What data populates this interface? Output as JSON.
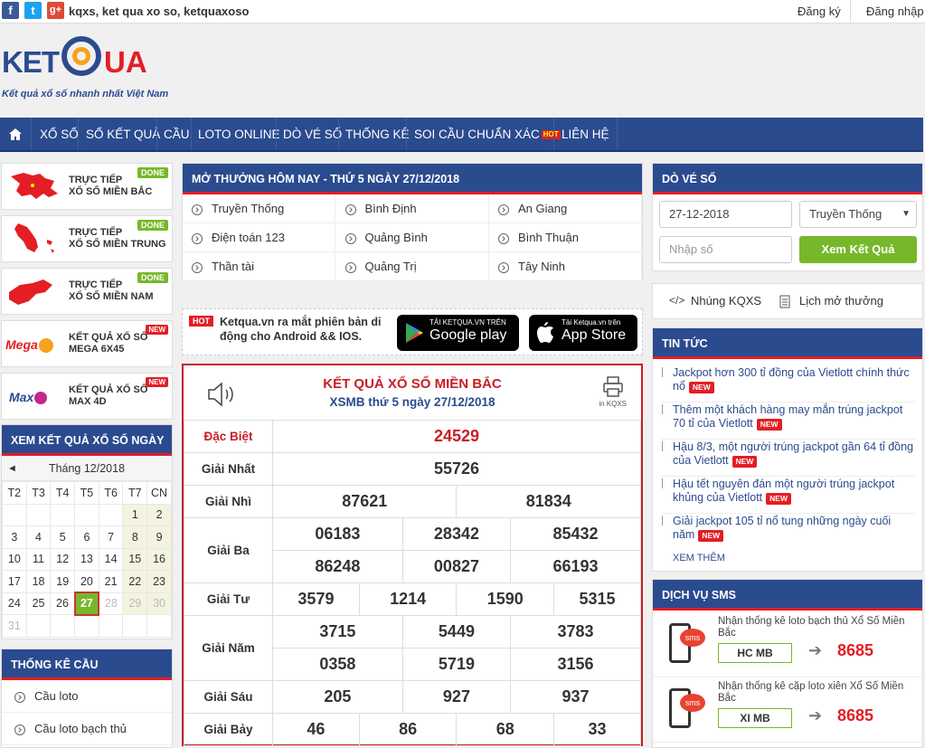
{
  "topbar": {
    "site_text": "kqxs, ket qua xo so, ketquaxoso",
    "register": "Đăng ký",
    "login": "Đăng nhập",
    "social": [
      {
        "name": "facebook-icon",
        "glyph": "f",
        "color": "#3b5998"
      },
      {
        "name": "twitter-icon",
        "glyph": "t",
        "color": "#1da1f2"
      },
      {
        "name": "google-plus-icon",
        "glyph": "g+",
        "color": "#dd4b39"
      }
    ]
  },
  "logo": {
    "text_left": "KET",
    "text_right": "UA",
    "tagline": "Kết quả xổ số nhanh nhất Việt Nam"
  },
  "nav": {
    "home_icon": "home-icon",
    "items": [
      "XỔ SỐ",
      "SỔ KẾT QUẢ",
      "CẦU",
      "LOTO ONLINE",
      "DÒ VÉ SỐ",
      "THỐNG KÊ",
      "SOI CẦU CHUẨN XÁC",
      "LIÊN HỆ"
    ],
    "hot_badge": "HOT"
  },
  "left_cards": [
    {
      "line1": "TRỰC TIẾP",
      "line2": "XỔ SỐ MIỀN BẮC",
      "badge": "DONE"
    },
    {
      "line1": "TRỰC TIẾP",
      "line2": "XỔ SỐ MIỀN TRUNG",
      "badge": "DONE"
    },
    {
      "line1": "TRỰC TIẾP",
      "line2": "XỔ SỐ MIỀN NAM",
      "badge": "DONE"
    },
    {
      "line1": "KẾT QUẢ XỔ SỐ",
      "line2": "MEGA 6X45",
      "badge": "NEW",
      "logo": "Mega"
    },
    {
      "line1": "KẾT QUẢ XỔ SỐ",
      "line2": "MAX 4D",
      "badge": "NEW",
      "logo": "Max"
    }
  ],
  "calendar": {
    "title": "XEM KẾT QUẢ XỔ SỐ NGÀY",
    "month": "Tháng 12/2018",
    "prev": "◄",
    "weekdays": [
      "T2",
      "T3",
      "T4",
      "T5",
      "T6",
      "T7",
      "CN"
    ],
    "weeks": [
      [
        "",
        "",
        "",
        "",
        "",
        "1",
        "2"
      ],
      [
        "3",
        "4",
        "5",
        "6",
        "7",
        "8",
        "9"
      ],
      [
        "10",
        "11",
        "12",
        "13",
        "14",
        "15",
        "16"
      ],
      [
        "17",
        "18",
        "19",
        "20",
        "21",
        "22",
        "23"
      ],
      [
        "24",
        "25",
        "26",
        "27",
        "28",
        "29",
        "30"
      ],
      [
        "31",
        "",
        "",
        "",
        "",
        "",
        ""
      ]
    ],
    "today": "27"
  },
  "thongke_cau": {
    "title": "THỐNG KÊ CẦU",
    "items": [
      "Cầu loto",
      "Cầu loto bạch thủ"
    ]
  },
  "mo_thuong": {
    "title": "MỞ THƯỞNG HÔM NAY - THỨ 5 NGÀY 27/12/2018",
    "cells": [
      "Truyền Thống",
      "Bình Định",
      "An Giang",
      "Điện toán 123",
      "Quảng Bình",
      "Bình Thuận",
      "Thần tài",
      "Quảng Trị",
      "Tây Ninh"
    ]
  },
  "app_promo": {
    "hot": "HOT",
    "text": "Ketqua.vn ra mắt phiên bản di động cho Android && IOS.",
    "google_small": "TẢI KETQUA.VN TRÊN",
    "google_big": "Google play",
    "apple_small": "Tải Ketqua.vn trên",
    "apple_big": "App Store"
  },
  "result": {
    "title": "KẾT QUẢ XỔ SỐ MIỀN BẮC",
    "subtitle": "XSMB thứ 5 ngày 27/12/2018",
    "print_label": "in KQXS",
    "labels": [
      "Đặc Biệt",
      "Giải Nhất",
      "Giải Nhì",
      "Giải Ba",
      "Giải Tư",
      "Giải Năm",
      "Giải Sáu",
      "Giải Bảy"
    ],
    "db": "24529",
    "nhat": "55726",
    "nhi": [
      "87621",
      "81834"
    ],
    "ba": [
      "06183",
      "28342",
      "85432",
      "86248",
      "00827",
      "66193"
    ],
    "tu": [
      "3579",
      "1214",
      "1590",
      "5315"
    ],
    "nam": [
      "3715",
      "5449",
      "3783",
      "0358",
      "5719",
      "3156"
    ],
    "sau": [
      "205",
      "927",
      "937"
    ],
    "bay": [
      "46",
      "86",
      "68",
      "33"
    ]
  },
  "do_ve_so": {
    "title": "DÒ VÉ SỐ",
    "date": "27-12-2018",
    "type": "Truyền Thống",
    "number_placeholder": "Nhập số",
    "button": "Xem Kết Quả"
  },
  "links": {
    "embed": "Nhúng KQXS",
    "schedule": "Lịch mở thưởng"
  },
  "news": {
    "title": "TIN TỨC",
    "new_badge": "NEW",
    "more": "XEM THÊM",
    "items": [
      "Jackpot hơn 300 tỉ đồng của Vietlott chính thức nổ",
      "Thêm một khách hàng may mắn trúng jackpot 70 tỉ của Vietlott",
      "Hậu 8/3, một người trúng jackpot gần 64 tỉ đồng của Vietlott",
      "Hậu tết nguyên đán một người trúng jackpot khủng của Vietlott",
      "Giải jackpot 105 tỉ nổ tung những ngày cuối năm"
    ]
  },
  "sms": {
    "title": "DỊCH VỤ SMS",
    "bubble": "sms",
    "items": [
      {
        "desc": "Nhận thống kê loto bạch thủ Xổ Số Miền Bắc",
        "code": "HC MB",
        "number": "8685"
      },
      {
        "desc": "Nhận thống kê cặp loto xiên Xổ Số Miền Bắc",
        "code": "XI MB",
        "number": "8685"
      }
    ]
  },
  "colors": {
    "brand_blue": "#2b4b8f",
    "accent_red": "#e31e25",
    "green": "#76b82a"
  }
}
